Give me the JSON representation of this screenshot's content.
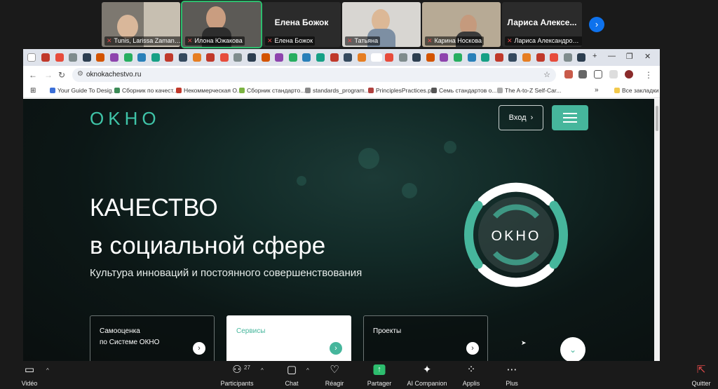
{
  "meeting": {
    "participants": [
      {
        "name": "Tunis, Larissa Zamano...",
        "video": true
      },
      {
        "name": "Илона Южакова",
        "video": true,
        "active": true
      },
      {
        "name": "Елена Божок",
        "display_name": "Елена Божок",
        "video": false
      },
      {
        "name": "Татьяна",
        "video": true
      },
      {
        "name": "Карина Носкова",
        "video": true
      },
      {
        "name": "Лариса Александровн...",
        "display_name": "Лариса  Алексe...",
        "video": false
      }
    ],
    "toolbar": {
      "video_label": "Vidéo",
      "participants_label": "Participants",
      "participants_count": "27",
      "chat_label": "Chat",
      "react_label": "Réagir",
      "share_label": "Partager",
      "ai_label": "AI Companion",
      "apps_label": "Applis",
      "plus_label": "Plus",
      "quit_label": "Quitter"
    }
  },
  "browser": {
    "url": "oknokachestvo.ru",
    "bookmarks": [
      "Your Guide To Desig...",
      "Сборник по качест...",
      "Некоммерческая О...",
      "Сборник стандарто...",
      "standards_program...",
      "PrinciplesPractices.p...",
      "Семь стандартов о...",
      "The A-to-Z Self-Car..."
    ],
    "all_bookmarks": "Все закладки"
  },
  "site": {
    "logo_text": "OKHO",
    "login_label": "Вход",
    "hero_title_line1": "КАЧЕСТВО",
    "hero_title_line2": "в социальной сфере",
    "hero_subtitle": "Культура инноваций и постоянного совершенствования",
    "emblem_text": "OKHO",
    "cards": [
      {
        "line1": "Самооценка",
        "line2": "по Системе ОКНО"
      },
      {
        "line1": "Сервисы",
        "line2": ""
      },
      {
        "line1": "Проекты",
        "line2": ""
      }
    ]
  },
  "colors": {
    "accent": "#46b69c",
    "zoom_blue": "#0e72ed",
    "active_speaker": "#2dbd6e"
  }
}
